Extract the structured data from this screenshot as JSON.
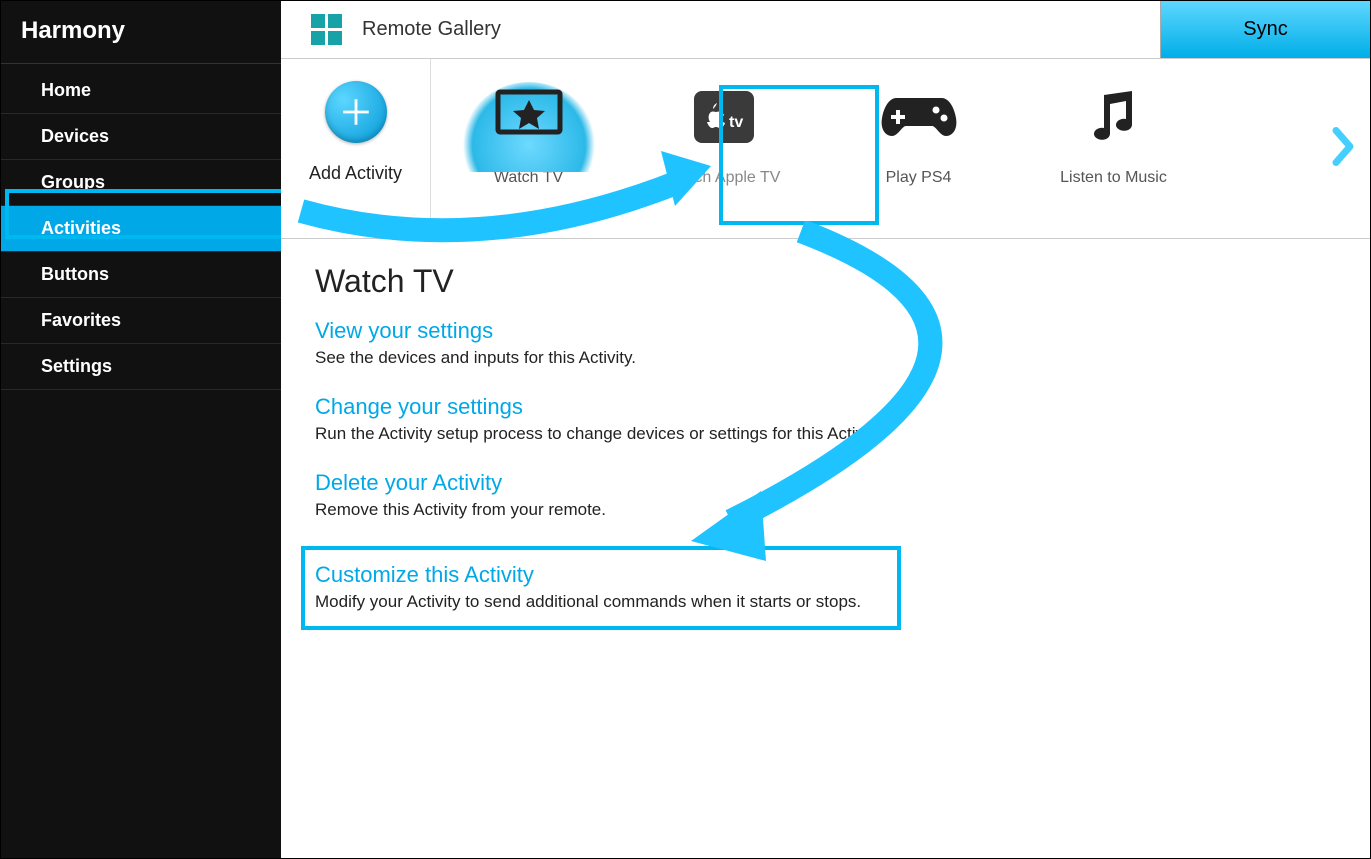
{
  "sidebar": {
    "title": "Harmony",
    "items": [
      {
        "label": "Home"
      },
      {
        "label": "Devices"
      },
      {
        "label": "Groups"
      },
      {
        "label": "Activities"
      },
      {
        "label": "Buttons"
      },
      {
        "label": "Favorites"
      },
      {
        "label": "Settings"
      }
    ],
    "active_index": 3
  },
  "topbar": {
    "title": "Remote Gallery",
    "sync_label": "Sync"
  },
  "activity_strip": {
    "add_label": "Add Activity",
    "activities": [
      {
        "label": "Watch TV",
        "icon": "tv-star"
      },
      {
        "label": "Watch Apple TV",
        "icon": "apple-tv"
      },
      {
        "label": "Play PS4",
        "icon": "gamepad"
      },
      {
        "label": "Listen to Music",
        "icon": "music-note"
      }
    ],
    "selected_index": 1
  },
  "details": {
    "title": "Watch TV",
    "sections": [
      {
        "heading": "View your settings",
        "desc": "See the devices and inputs for this Activity."
      },
      {
        "heading": "Change your settings",
        "desc": "Run the Activity setup process to change devices or settings for this Activity."
      },
      {
        "heading": "Delete your Activity",
        "desc": "Remove this Activity from your remote."
      },
      {
        "heading": "Customize this Activity",
        "desc": "Modify your Activity to send additional commands when it starts or stops."
      }
    ],
    "highlighted_section_index": 3
  }
}
